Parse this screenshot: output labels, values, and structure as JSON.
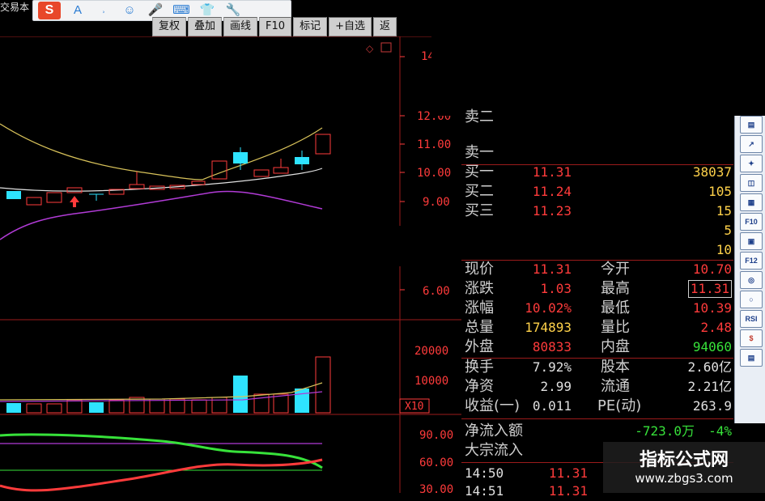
{
  "app": {
    "title": "交易本"
  },
  "ime_toolbar": {
    "logo": "S",
    "items": [
      "A",
      "˒",
      "☺",
      "🎤",
      "⌨",
      "👕",
      "🔧"
    ]
  },
  "toolbar": {
    "buttons": [
      "复权",
      "叠加",
      "画线",
      "F10",
      "标记",
      "+自选",
      "返"
    ]
  },
  "price_axis": {
    "labels": [
      "14",
      "12.00",
      "11.00",
      "10.00",
      "9.00",
      "6.00"
    ]
  },
  "volume_axis": {
    "labels": [
      "20000",
      "10000",
      "X10"
    ]
  },
  "indicator_axis": {
    "labels": [
      "90.00",
      "60.00",
      "30.00"
    ]
  },
  "orderbook": {
    "sells": [
      {
        "label": "卖二"
      },
      {
        "label": "卖一"
      }
    ],
    "buys": [
      {
        "label": "买一",
        "price": "11.31",
        "volume": "38037"
      },
      {
        "label": "买二",
        "price": "11.24",
        "volume": "105"
      },
      {
        "label": "买三",
        "price": "11.23",
        "volume": "15"
      },
      {
        "label": "",
        "price": "",
        "volume": "5"
      },
      {
        "label": "",
        "price": "",
        "volume": "10"
      }
    ]
  },
  "stats": [
    {
      "l1": "现价",
      "v1": "11.31",
      "l2": "今开",
      "v2": "10.70"
    },
    {
      "l1": "涨跌",
      "v1": "1.03",
      "l2": "最高",
      "v2": "11.31"
    },
    {
      "l1": "涨幅",
      "v1": "10.02%",
      "l2": "最低",
      "v2": "10.39"
    },
    {
      "l1": "总量",
      "v1": "174893",
      "l2": "量比",
      "v2": "2.48"
    },
    {
      "l1": "外盘",
      "v1": "80833",
      "l2": "内盘",
      "v2": "94060"
    },
    {
      "l1": "换手",
      "v1": "7.92%",
      "l2": "股本",
      "v2": "2.60亿"
    },
    {
      "l1": "净资",
      "v1": "2.99",
      "l2": "流通",
      "v2": "2.21亿"
    },
    {
      "l1": "收益(一)",
      "v1": "0.011",
      "l2": "PE(动)",
      "v2": "263.9"
    }
  ],
  "flow": {
    "net_label": "净流入额",
    "net_value": "-723.0万",
    "net_pct": "-4%",
    "block_label": "大宗流入"
  },
  "ticks": [
    {
      "time": "14:50",
      "price": "11.31"
    },
    {
      "time": "14:51",
      "price": "11.31"
    }
  ],
  "sidebar": {
    "buttons": [
      "▤",
      "↗",
      "✦",
      "◫",
      "▦",
      "F10",
      "▣",
      "F12",
      "◎",
      "○",
      "RSI",
      "$",
      "▤"
    ]
  },
  "watermark": {
    "title": "指标公式网",
    "url": "www.zbgs3.com"
  },
  "colors": {
    "up": "#ff3b3b",
    "down": "#2ee3ff",
    "flat": "#cfcfcf",
    "green": "#37e23a",
    "yellow": "#ffd24a",
    "ma_yellow": "#d8c25a",
    "ma_purple": "#b13bd6"
  }
}
